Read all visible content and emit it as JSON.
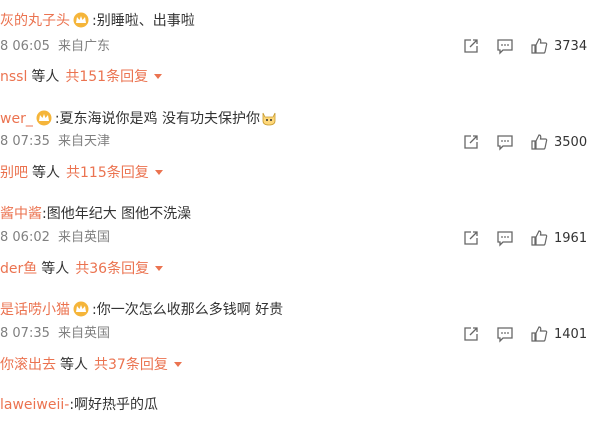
{
  "comments": [
    {
      "username": "灰的丸子头",
      "text": ":别睡啦、出事啦",
      "date": "8 06:05",
      "location": "来自广东",
      "likes": "3734",
      "reply_user": "nssl",
      "reply_suffix": "等人",
      "reply_count": "共151条回复"
    },
    {
      "username": "wer_",
      "text": ":夏东海说你是鸡 没有功夫保护你",
      "date": "8 07:35",
      "location": "来自天津",
      "likes": "3500",
      "reply_user": "别吧",
      "reply_suffix": "等人",
      "reply_count": "共115条回复"
    },
    {
      "username": "酱中酱",
      "text": ":图他年纪大 图他不洗澡",
      "date": "8 06:02",
      "location": "来自英国",
      "likes": "1961",
      "reply_user": "der鱼",
      "reply_suffix": "等人",
      "reply_count": "共36条回复"
    },
    {
      "username": "是话唠小猫",
      "text": ":你一次怎么收那么多钱啊 好贵",
      "date": "8 07:35",
      "location": "来自英国",
      "likes": "1401",
      "reply_user": "你滚出去",
      "reply_suffix": "等人",
      "reply_count": "共37条回复"
    },
    {
      "username": "laweiweii-",
      "text": ":啊好热乎的瓜"
    }
  ],
  "colors": {
    "username": "#eb7350",
    "text": "#333333",
    "meta": "#808080"
  },
  "icons": [
    "crown-icon",
    "share-icon",
    "comment-icon",
    "like-icon",
    "caret-down-icon",
    "cat-emoji-icon"
  ]
}
